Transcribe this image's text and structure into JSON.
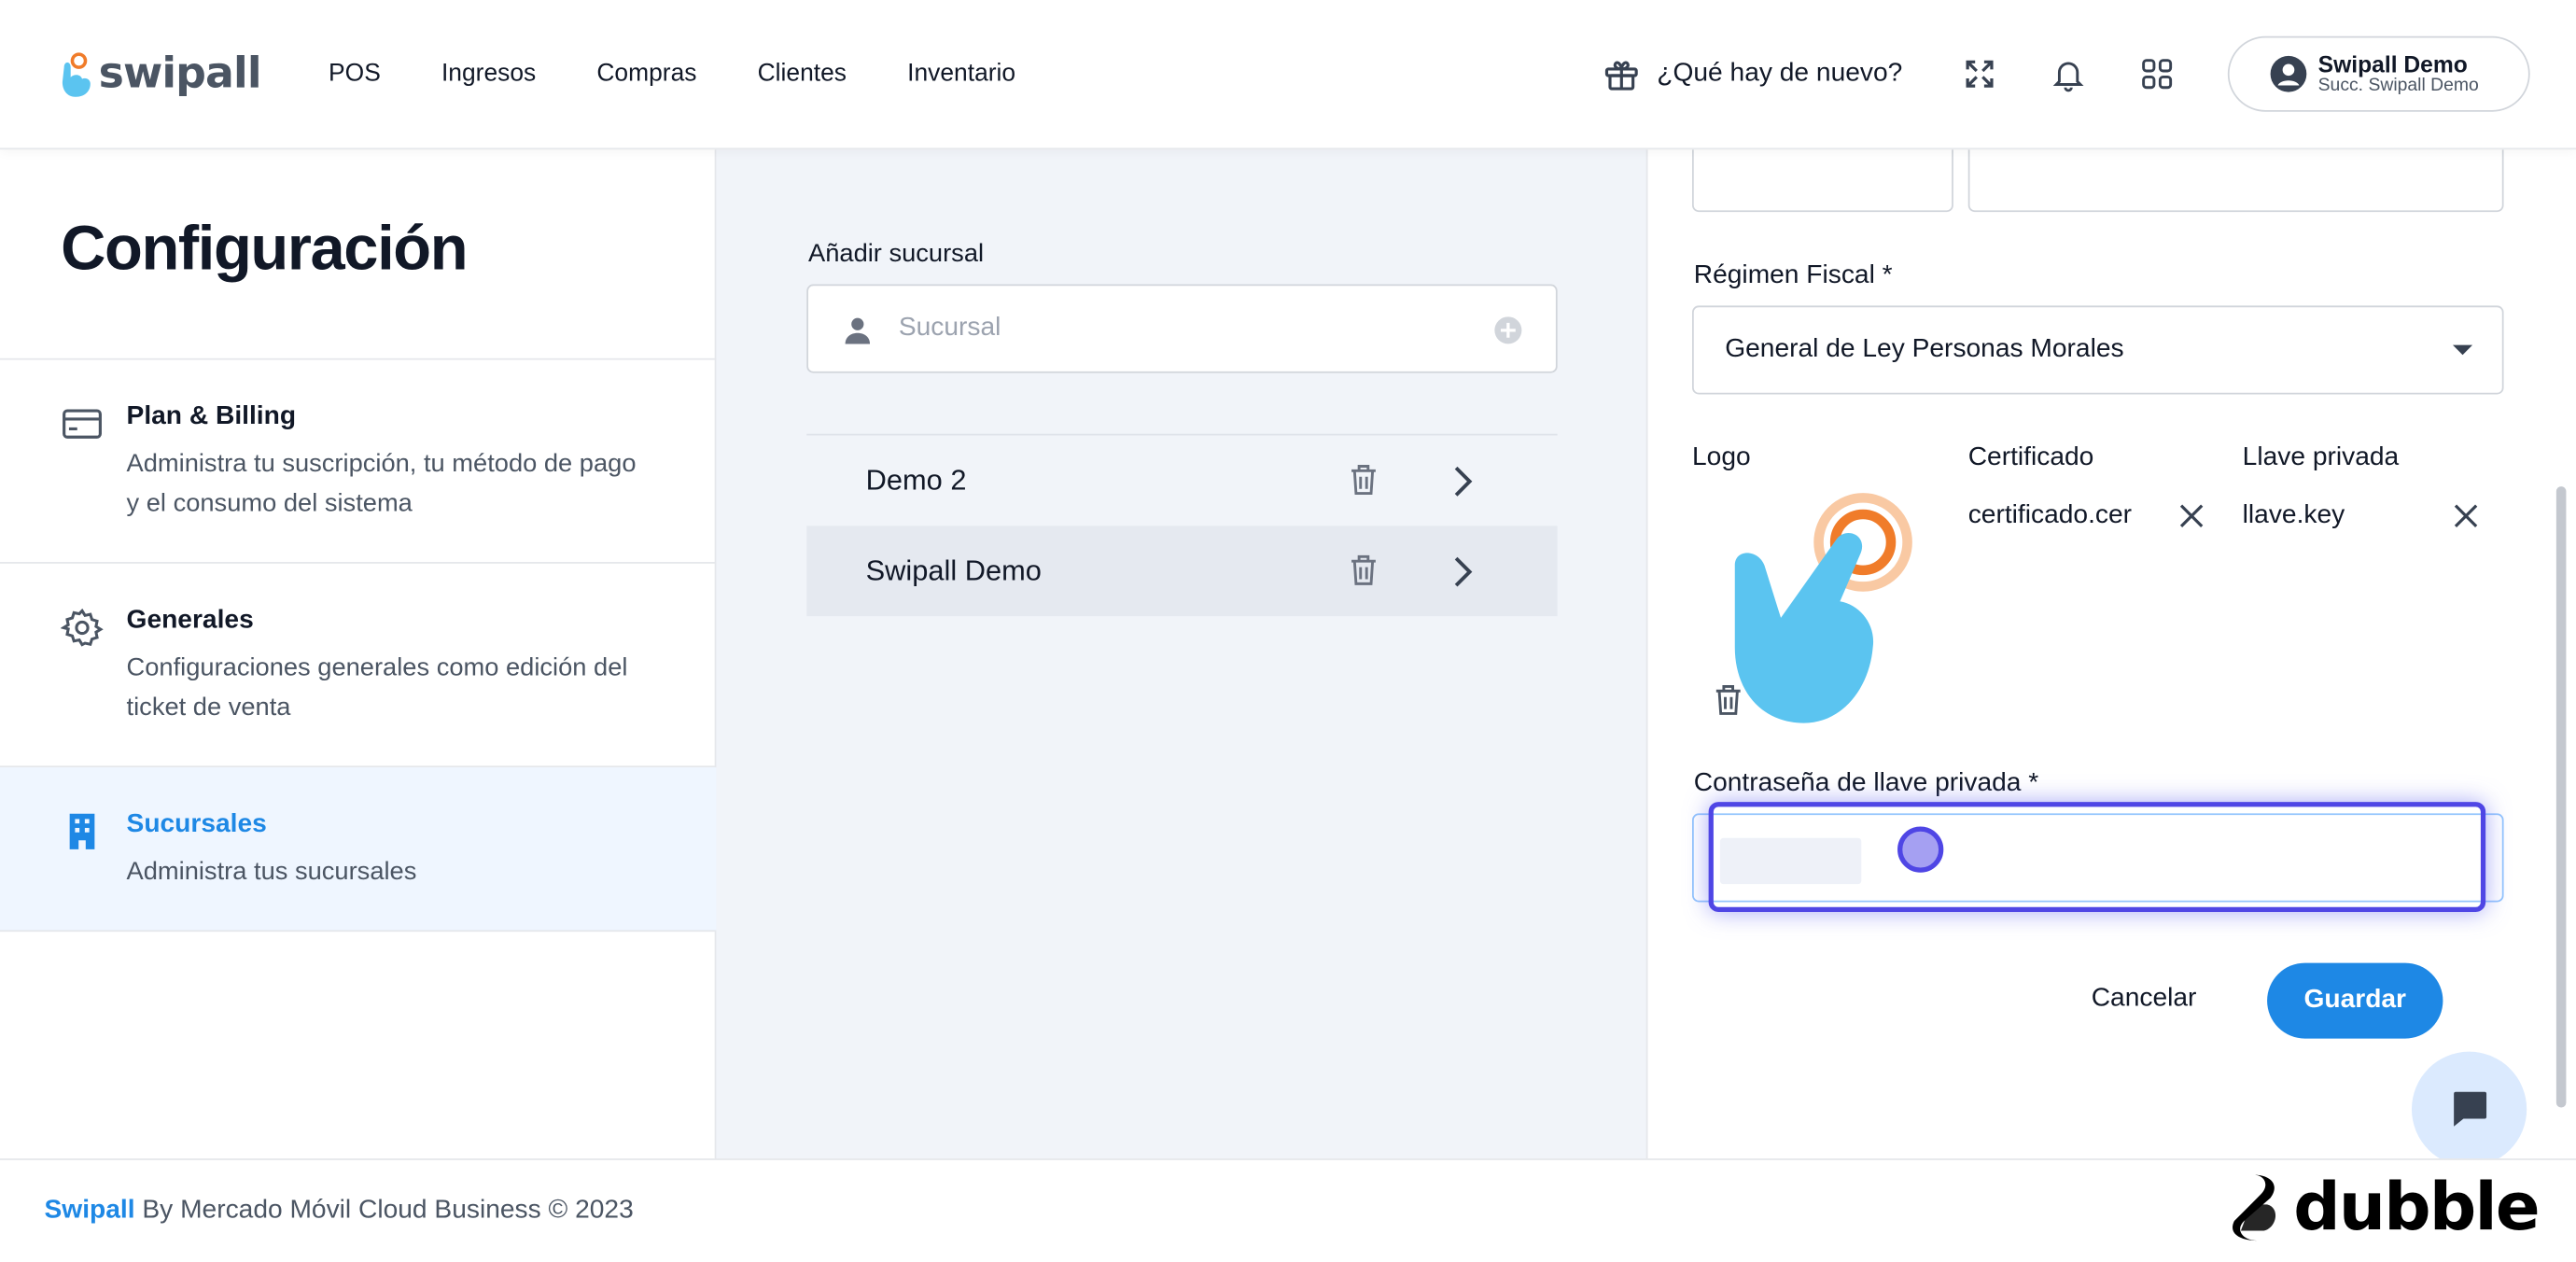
{
  "brand": {
    "logo_text": "swipall"
  },
  "nav": {
    "items": [
      "POS",
      "Ingresos",
      "Compras",
      "Clientes",
      "Inventario"
    ]
  },
  "header": {
    "whats_new": "¿Qué hay de nuevo?",
    "user_name": "Swipall Demo",
    "user_branch": "Succ. Swipall Demo"
  },
  "sidebar": {
    "title": "Configuración",
    "items": [
      {
        "title": "Plan & Billing",
        "desc": "Administra tu suscripción, tu método de pago y el consumo del sistema",
        "icon": "credit-card-icon"
      },
      {
        "title": "Generales",
        "desc": "Configuraciones generales como edición del ticket de venta",
        "icon": "gear-icon"
      },
      {
        "title": "Sucursales",
        "desc": "Administra tus sucursales",
        "icon": "building-icon",
        "active": true
      }
    ]
  },
  "branches": {
    "add_label": "Añadir sucursal",
    "input_placeholder": "Sucursal",
    "list": [
      {
        "name": "Demo 2"
      },
      {
        "name": "Swipall Demo",
        "selected": true
      }
    ]
  },
  "form": {
    "regime_label": "Régimen Fiscal *",
    "regime_value": "General de Ley Personas Morales",
    "logo_label": "Logo",
    "cert_label": "Certificado",
    "cert_value": "certificado.cer",
    "key_label": "Llave privada",
    "key_value": "llave.key",
    "password_label": "Contraseña de llave privada *",
    "cancel": "Cancelar",
    "save": "Guardar"
  },
  "footer": {
    "brand": "Swipall",
    "text": " By Mercado Móvil Cloud Business © 2023"
  },
  "watermark": {
    "text": "dubble"
  },
  "colors": {
    "accent": "#1e88e5",
    "highlight": "#4f46e5",
    "hand": "#5bc4f0",
    "orange": "#f07c2a"
  }
}
